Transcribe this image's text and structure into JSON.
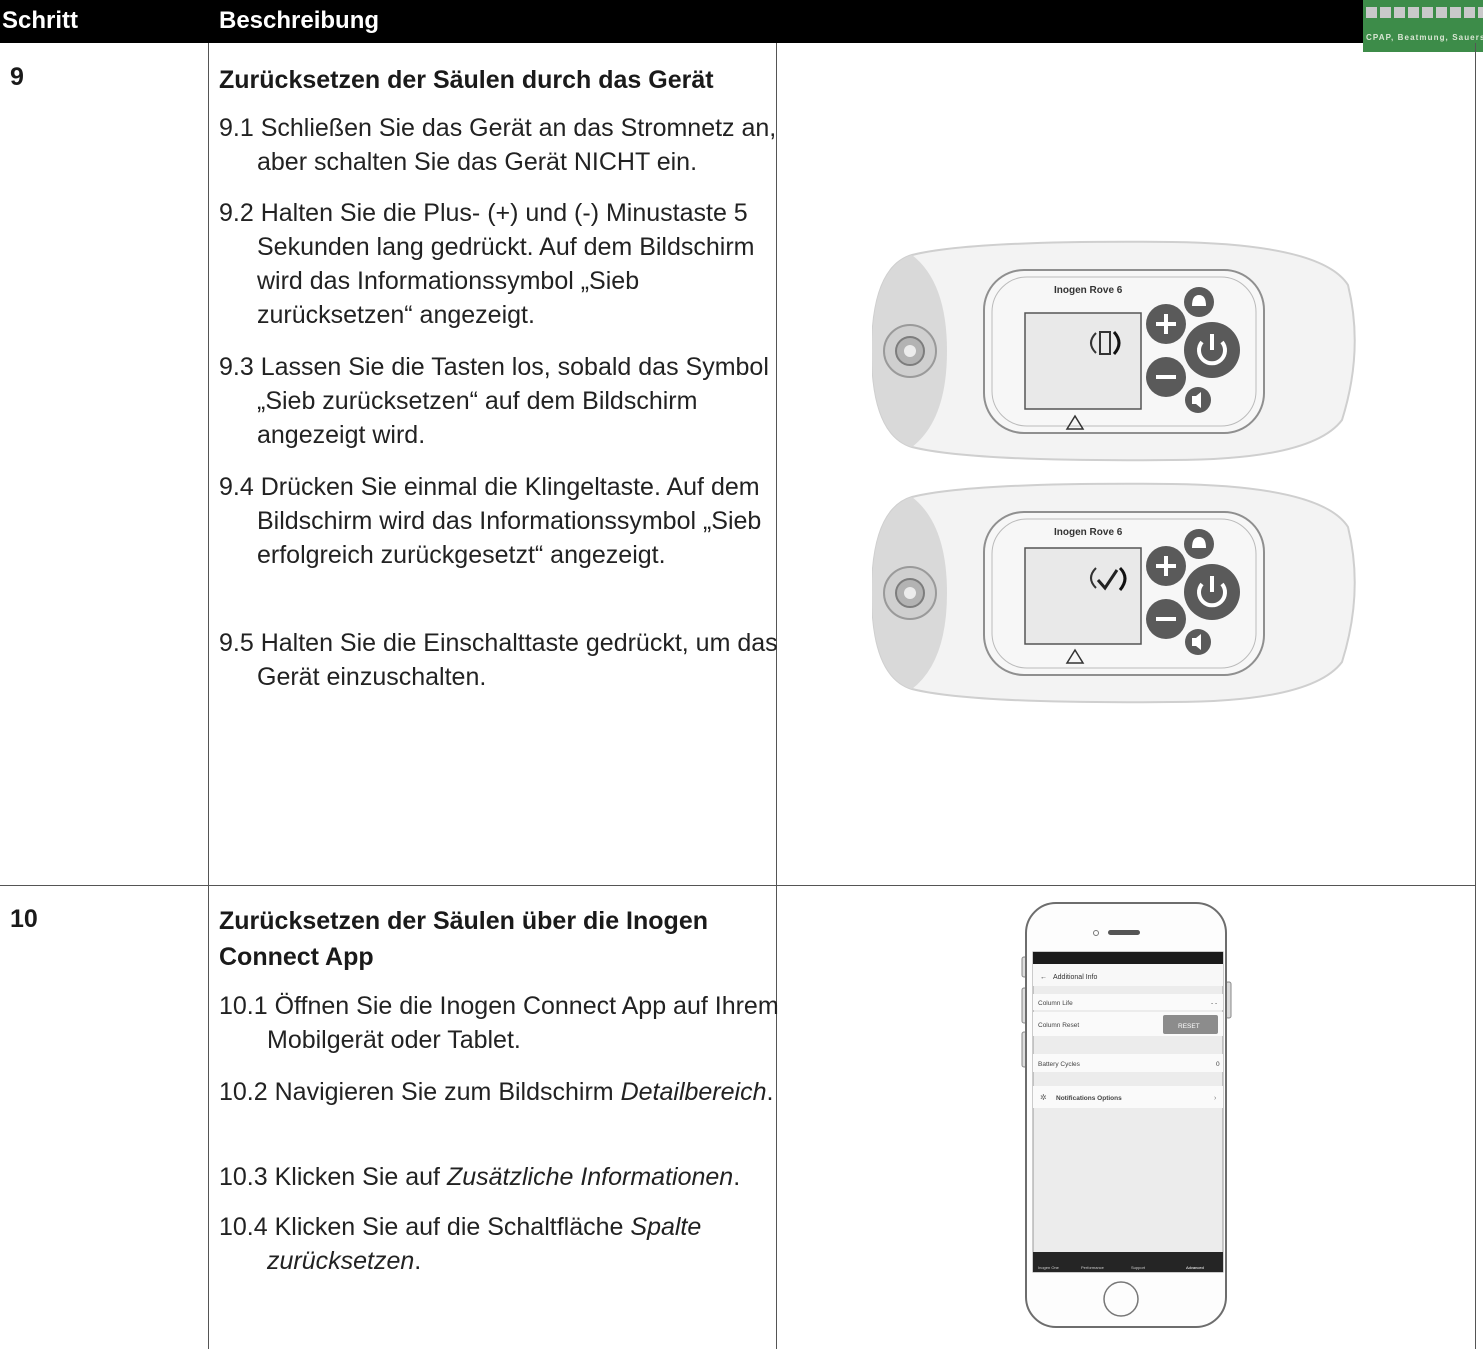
{
  "header": {
    "col_step": "Schritt",
    "col_desc": "Beschreibung"
  },
  "logo": {
    "tagline": "CPAP, Beatmung, Sauerstoff, Zu"
  },
  "steps": [
    {
      "number": "9",
      "title": "Zurücksetzen der Säulen durch das Gerät",
      "items": [
        {
          "prefix": "9.1 ",
          "text": "Schließen Sie das Gerät an das Stromnetz an, aber schalten Sie das Gerät NICHT ein."
        },
        {
          "prefix": "9.2 ",
          "text": "Halten Sie die Plus- (+) und (-) Minustaste 5 Sekunden lang gedrückt. Auf dem Bildschirm wird das Informationssymbol „Sieb zurücksetzen“ angezeigt."
        },
        {
          "prefix": "9.3 ",
          "text": "Lassen Sie die Tasten los, sobald das Symbol „Sieb zurücksetzen“ auf dem Bildschirm angezeigt wird."
        },
        {
          "prefix": "9.4 ",
          "text": "Drücken Sie einmal die Klingeltaste. Auf dem Bildschirm wird das Informationssymbol „Sieb erfolgreich zurückgesetzt“ angezeigt."
        },
        {
          "prefix": "9.5 ",
          "text": "Halten Sie die Einschalttaste gedrückt, um das Gerät einzuschalten."
        }
      ],
      "device_label": "Inogen Rove 6"
    },
    {
      "number": "10",
      "title": "Zurücksetzen der Säulen über die Inogen Connect App",
      "items": [
        {
          "prefix": "10.1 ",
          "text": "Öffnen Sie die Inogen Connect App auf Ihrem Mobilgerät oder Tablet."
        },
        {
          "prefix": "10.2 ",
          "text": "Navigieren Sie zum Bildschirm",
          "em": "Detailbereich",
          "after": "."
        },
        {
          "prefix": "10.3 ",
          "text": "Klicken Sie auf",
          "em": "Zusätzliche Informationen",
          "after": "."
        },
        {
          "prefix": "10.4 ",
          "text": "Klicken Sie auf die Schaltfläche",
          "em": "Spalte zurücksetzen",
          "after": "."
        }
      ]
    }
  ],
  "phone_app": {
    "screen_title": "Additional Info",
    "column_life_label": "Column Life",
    "column_life_value": "- -",
    "column_reset_label": "Column Reset",
    "reset_button": "RESET",
    "battery_cycles_label": "Battery Cycles",
    "battery_cycles_value": "0",
    "notifications_label": "Notifications Options",
    "tabs": [
      "Inogen One",
      "Performance",
      "Support",
      "Advanced"
    ]
  }
}
